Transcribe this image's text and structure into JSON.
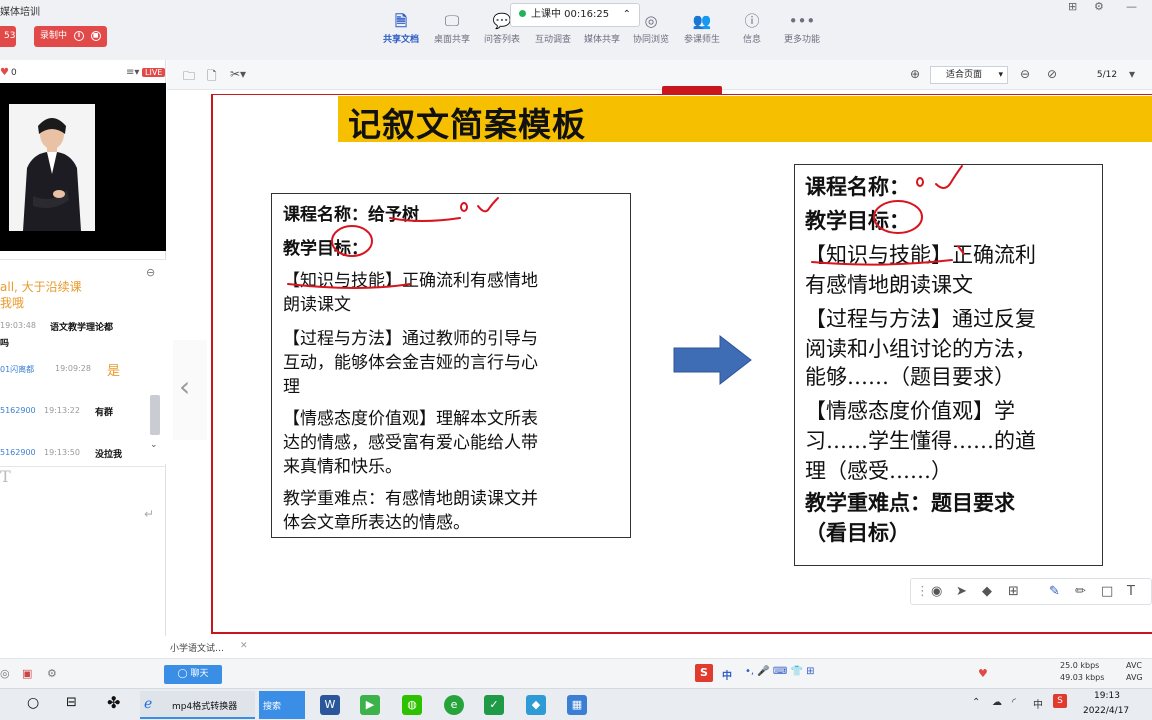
{
  "app": {
    "title": "媒体培训",
    "recording_left_label": "53",
    "recording_label": "录制中"
  },
  "toolbar": {
    "tools": [
      {
        "label": "共享文档",
        "icon": "document-icon"
      },
      {
        "label": "桌面共享",
        "icon": "desktop-icon"
      },
      {
        "label": "问答列表",
        "icon": "qa-icon"
      },
      {
        "label": "互动调查",
        "icon": "survey-icon"
      },
      {
        "label": "媒体共享",
        "icon": "media-icon"
      },
      {
        "label": "协同浏览",
        "icon": "browse-icon"
      },
      {
        "label": "参课师生",
        "icon": "people-icon"
      },
      {
        "label": "信息",
        "icon": "info-icon"
      },
      {
        "label": "更多功能",
        "icon": "more-icon"
      }
    ],
    "timer": "上课中 00:16:25"
  },
  "left": {
    "count": "0",
    "live_badge": "LIVE",
    "chat": {
      "line1": "all, 大于沿续课",
      "line2": "我哦",
      "line3_time": "19:03:48",
      "line3_msg": "语文教学理论都",
      "line4_msg": "吗",
      "line5_user": "01闪离都",
      "line5_time": "19:09:28",
      "line5_msg": "是",
      "line6_user": "5162900",
      "line6_time": "19:13:22",
      "line6_msg": "有群",
      "line7_user": "5162900",
      "line7_time": "19:13:50",
      "line7_msg": "没拉我"
    }
  },
  "slide_toolbar": {
    "zoom": "适合页面",
    "page": "5/12"
  },
  "slide": {
    "title": "记叙文简案模板",
    "left_box": {
      "course": "课程名称：给予树",
      "goal_heading": "教学目标：",
      "knowledge1": "【知识与技能】正确流利有感情地",
      "knowledge2": "朗读课文",
      "process1": "【过程与方法】通过教师的引导与",
      "process2": "互动，能够体会金吉娅的言行与心",
      "process3": "理",
      "emotion1": "【情感态度价值观】理解本文所表",
      "emotion2": "达的情感，感受富有爱心能给人带",
      "emotion3": "来真情和快乐。",
      "key1": "教学重难点：有感情地朗读课文并",
      "key2": "体会文章所表达的情感。"
    },
    "right_box": {
      "course": "课程名称：",
      "goal_heading": "教学目标：",
      "knowledge1": "【知识与技能】正确流利",
      "knowledge2": "有感情地朗读课文",
      "process1": "【过程与方法】通过反复",
      "process2": "阅读和小组讨论的方法，",
      "process3": "能够……（题目要求）",
      "emotion1": "【情感态度价值观】学",
      "emotion2": "习……学生懂得……的道",
      "emotion3": "理（感受……）",
      "key1": "教学重难点：题目要求",
      "key2": "（看目标）"
    }
  },
  "bottom": {
    "tab_label": "小学语文试…",
    "chat_button": "聊天",
    "net_up": "25.0 kbps",
    "net_down": "49.03 kbps",
    "net_label1": "AVC",
    "net_label2": "AVG",
    "ime": "中"
  },
  "taskbar": {
    "app1": "mp4格式转换器",
    "app2": "搜索",
    "time": "19:13",
    "date": "2022/4/17",
    "ime": "中"
  },
  "colors": {
    "accent": "#2f5ec7",
    "title_bar": "#f6c000",
    "slide_border": "#c8161d",
    "record": "#e24a4a",
    "arrow": "#3f6db5"
  }
}
